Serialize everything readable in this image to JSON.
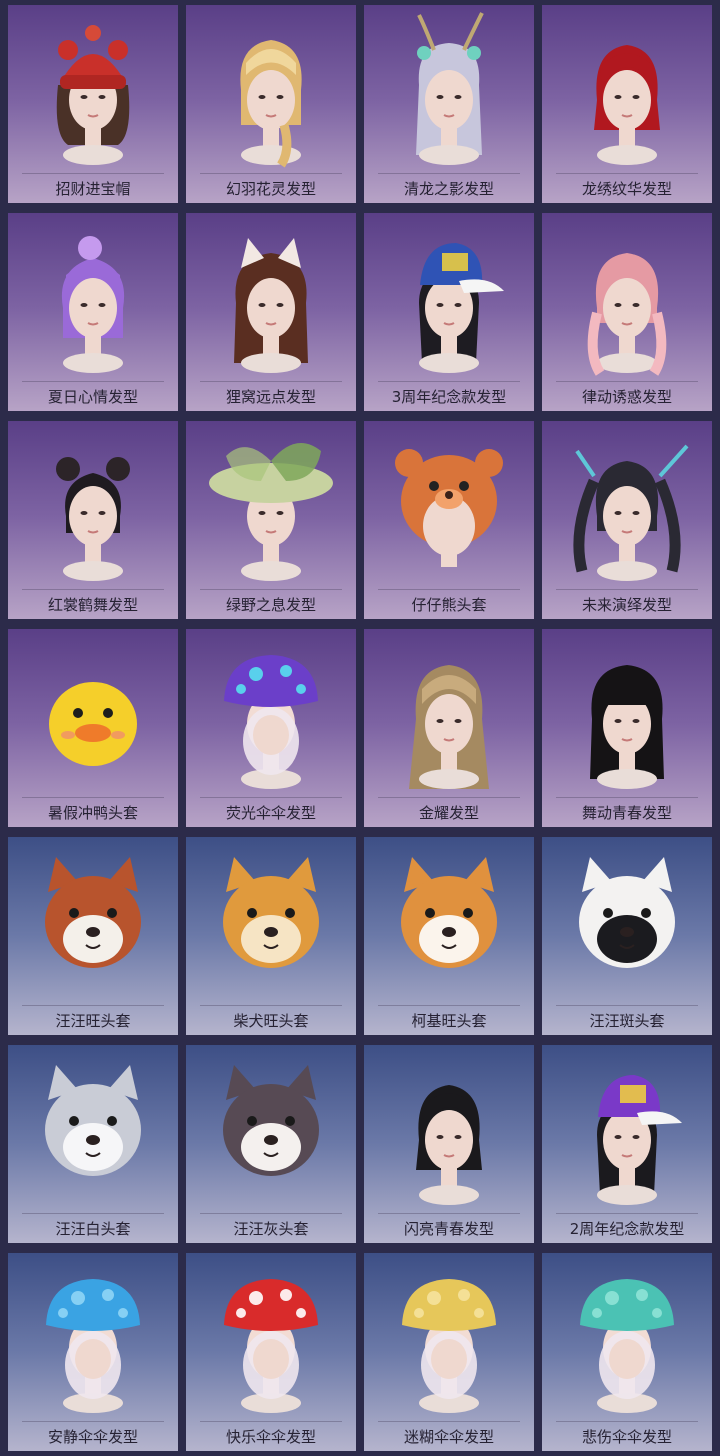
{
  "items": [
    {
      "name": "招财进宝帽",
      "icon": "red-knit-hat-hairstyle-icon",
      "theme": "purple",
      "hair": "#4a3127",
      "accent": "#c9302a",
      "kind": "hat"
    },
    {
      "name": "幻羽花灵发型",
      "icon": "blonde-braid-hairstyle-icon",
      "theme": "purple",
      "hair": "#e0b871",
      "accent": "#f0d79c",
      "kind": "braid"
    },
    {
      "name": "清龙之影发型",
      "icon": "silver-dragon-horn-hairstyle-icon",
      "theme": "purple",
      "hair": "#c7c6dc",
      "accent": "#bfa873",
      "kind": "horns"
    },
    {
      "name": "龙绣纹华发型",
      "icon": "red-bob-hairstyle-icon",
      "theme": "purple",
      "hair": "#b1181f",
      "accent": "#d62a2f",
      "kind": "bob"
    },
    {
      "name": "夏日心情发型",
      "icon": "purple-bun-hairstyle-icon",
      "theme": "purple",
      "hair": "#9a6ad8",
      "accent": "#c59aee",
      "kind": "bun"
    },
    {
      "name": "狸窝远点发型",
      "icon": "cat-ear-hairstyle-icon",
      "theme": "purple",
      "hair": "#5a2e21",
      "accent": "#f2e8e3",
      "kind": "catears"
    },
    {
      "name": "3周年纪念款发型",
      "icon": "blue-yellow-cap-hairstyle-icon",
      "theme": "purple",
      "hair": "#1e1c22",
      "accent": "#2f53b5",
      "kind": "cap"
    },
    {
      "name": "律动诱惑发型",
      "icon": "pink-twintail-hairstyle-icon",
      "theme": "purple",
      "hair": "#e59aa3",
      "accent": "#f3b9c0",
      "kind": "twintail"
    },
    {
      "name": "红裳鹤舞发型",
      "icon": "double-bun-hairstyle-icon",
      "theme": "purple",
      "hair": "#1f1b20",
      "accent": "#2c2428",
      "kind": "doublebun"
    },
    {
      "name": "绿野之息发型",
      "icon": "butterfly-hat-hairstyle-icon",
      "theme": "purple",
      "hair": "#2a2b22",
      "accent": "#7fa85a",
      "kind": "butterfly"
    },
    {
      "name": "仔仔熊头套",
      "icon": "bear-headgear-icon",
      "theme": "purple",
      "hair": "#d9743a",
      "accent": "#f2a26b",
      "kind": "bear"
    },
    {
      "name": "未来演绎发型",
      "icon": "cyber-twintail-hairstyle-icon",
      "theme": "purple",
      "hair": "#2a2933",
      "accent": "#5ec7d8",
      "kind": "cyber"
    },
    {
      "name": "暑假冲鸭头套",
      "icon": "duck-headgear-icon",
      "theme": "purple",
      "hair": "#f5cf2a",
      "accent": "#ef7b2a",
      "kind": "duck"
    },
    {
      "name": "荧光伞伞发型",
      "icon": "glowing-mushroom-hairstyle-icon",
      "theme": "purple",
      "hair": "#6b3fc9",
      "accent": "#58e0f0",
      "kind": "mushroom"
    },
    {
      "name": "金耀发型",
      "icon": "golden-long-hairstyle-icon",
      "theme": "purple",
      "hair": "#a58a61",
      "accent": "#c8ab7d",
      "kind": "long"
    },
    {
      "name": "舞动青春发型",
      "icon": "black-straight-hairstyle-icon",
      "theme": "purple",
      "hair": "#151315",
      "accent": "#2b2a2e",
      "kind": "straight"
    },
    {
      "name": "汪汪旺头套",
      "icon": "shiba-red-dog-headgear-icon",
      "theme": "blue",
      "hair": "#b8542d",
      "accent": "#f4f0ea",
      "kind": "dog"
    },
    {
      "name": "柴犬旺头套",
      "icon": "shiba-dog-headgear-icon",
      "theme": "blue",
      "hair": "#e09a3d",
      "accent": "#f6e4c4",
      "kind": "dog"
    },
    {
      "name": "柯基旺头套",
      "icon": "corgi-headgear-icon",
      "theme": "blue",
      "hair": "#e0913e",
      "accent": "#fbf4ec",
      "kind": "dog"
    },
    {
      "name": "汪汪斑头套",
      "icon": "dalmatian-headgear-icon",
      "theme": "blue",
      "hair": "#f3f2f1",
      "accent": "#1b1b1f",
      "kind": "dog"
    },
    {
      "name": "汪汪白头套",
      "icon": "white-husky-headgear-icon",
      "theme": "blue",
      "hair": "#c9ccd6",
      "accent": "#f6f6f8",
      "kind": "dog"
    },
    {
      "name": "汪汪灰头套",
      "icon": "gray-husky-headgear-icon",
      "theme": "blue",
      "hair": "#574a54",
      "accent": "#f4f0ee",
      "kind": "dog"
    },
    {
      "name": "闪亮青春发型",
      "icon": "black-bob-hairstyle-icon",
      "theme": "blue",
      "hair": "#1a191c",
      "accent": "#2c2b30",
      "kind": "bob"
    },
    {
      "name": "2周年纪念款发型",
      "icon": "purple-cap-hairstyle-icon",
      "theme": "blue",
      "hair": "#1b1a1e",
      "accent": "#7a39c8",
      "kind": "cap"
    },
    {
      "name": "安静伞伞发型",
      "icon": "blue-mushroom-hairstyle-icon",
      "theme": "blue",
      "hair": "#3aa3e3",
      "accent": "#8fd5f5",
      "kind": "mushroom"
    },
    {
      "name": "快乐伞伞发型",
      "icon": "red-spotted-mushroom-hairstyle-icon",
      "theme": "blue",
      "hair": "#d92b2b",
      "accent": "#ffffff",
      "kind": "mushroom"
    },
    {
      "name": "迷糊伞伞发型",
      "icon": "yellow-mushroom-hairstyle-icon",
      "theme": "blue",
      "hair": "#e6c75a",
      "accent": "#f5e29c",
      "kind": "mushroom"
    },
    {
      "name": "悲伤伞伞发型",
      "icon": "teal-mushroom-hairstyle-icon",
      "theme": "blue",
      "hair": "#4bc2b4",
      "accent": "#8fe3d6",
      "kind": "mushroom"
    }
  ]
}
